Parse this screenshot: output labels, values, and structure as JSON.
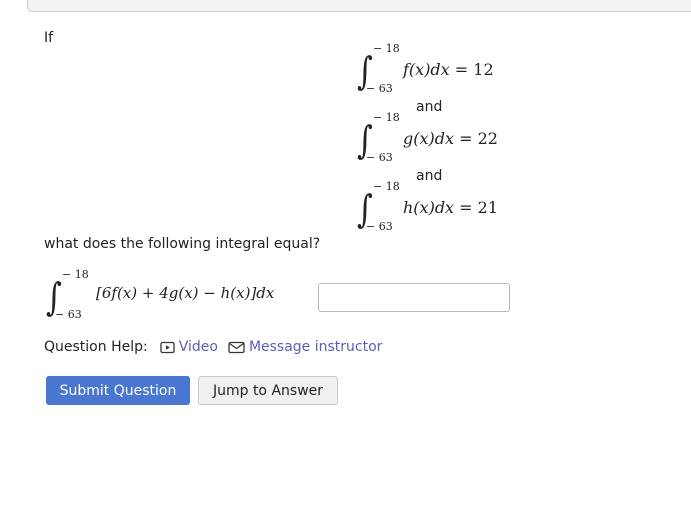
{
  "intro": "If",
  "integrals": [
    {
      "upper": "− 18",
      "lower": "− 63",
      "func": "f(x)dx",
      "value": "12"
    },
    {
      "upper": "− 18",
      "lower": "− 63",
      "func": "g(x)dx",
      "value": "22"
    },
    {
      "upper": "− 18",
      "lower": "− 63",
      "func": "h(x)dx",
      "value": "21"
    }
  ],
  "connector": "and",
  "question": "what does the following integral equal?",
  "target": {
    "upper": "− 18",
    "lower": "− 63",
    "expr": "[6f(x) + 4g(x) − h(x)]dx",
    "equals": "="
  },
  "answer": {
    "value": "",
    "placeholder": ""
  },
  "help": {
    "label": "Question Help:",
    "video": "Video",
    "message": "Message instructor"
  },
  "buttons": {
    "submit": "Submit Question",
    "jump": "Jump to Answer"
  },
  "colors": {
    "primary": "#4876d1",
    "link": "#5a5fb8"
  }
}
